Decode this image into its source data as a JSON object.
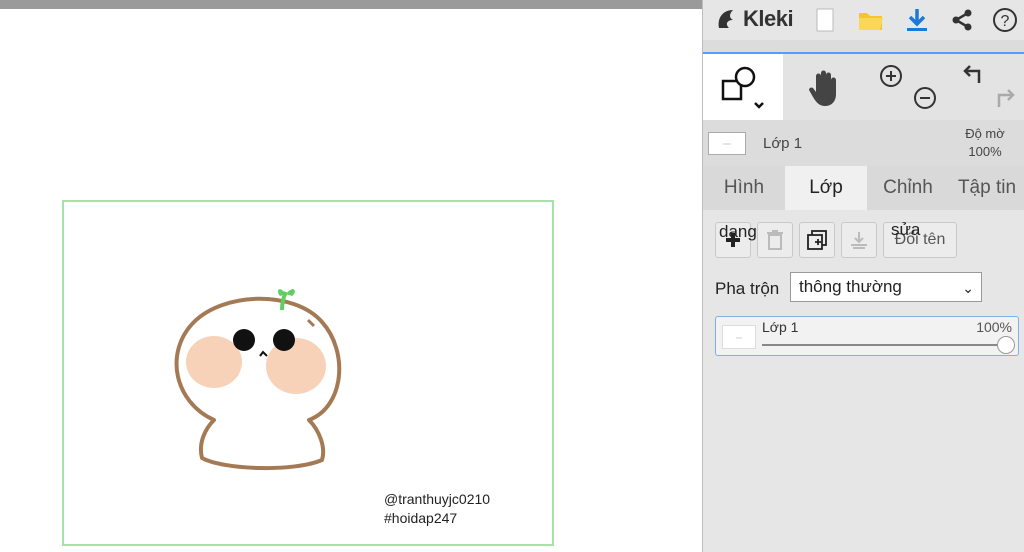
{
  "app": {
    "name": "Kleki"
  },
  "header": {
    "new_icon": "new-file-icon",
    "open_icon": "folder-open-icon",
    "download_icon": "download-icon",
    "share_icon": "share-icon",
    "help_icon": "help-icon"
  },
  "toolbar": {
    "shape_tool": "shape-tool-icon",
    "hand_tool": "hand-icon",
    "zoom_in": "zoom-in-icon",
    "zoom_out": "zoom-out-icon",
    "undo": "undo-icon",
    "redo": "redo-icon"
  },
  "layer_header": {
    "name": "Lớp 1",
    "opacity_label": "Độ mờ",
    "opacity_value": "100%"
  },
  "tabs": [
    {
      "label": "Hình"
    },
    {
      "label": "Lớp"
    },
    {
      "label": "Chỉnh"
    },
    {
      "label": "Tập tin"
    }
  ],
  "layer_actions": {
    "overlap_left": "dang",
    "overlap_right": "sửa",
    "rename": "Đổi tên"
  },
  "blend": {
    "label": "Pha trộn",
    "value": "thông thường"
  },
  "layers": [
    {
      "name": "Lớp 1",
      "opacity": "100%",
      "opacity_fraction": 1.0
    }
  ],
  "canvas": {
    "watermark_1": "@tranthuyjc0210",
    "watermark_2": "#hoidap247"
  },
  "colors": {
    "accent": "#4da0ff",
    "canvas_border": "#a9e2a9",
    "folder": "#f4c431"
  }
}
